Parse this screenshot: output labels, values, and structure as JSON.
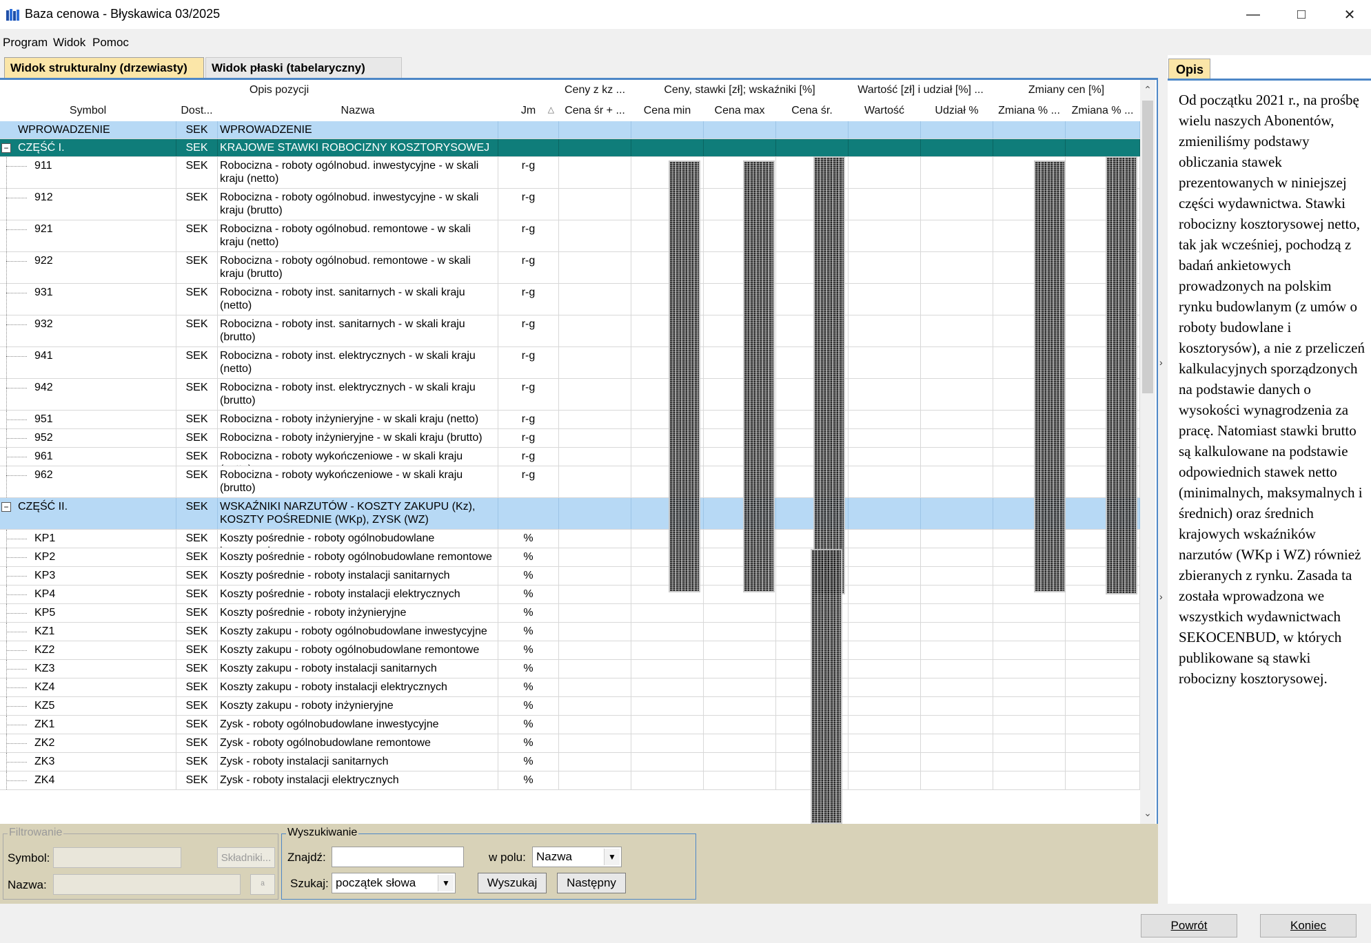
{
  "window": {
    "title": "Baza cenowa - Błyskawica 03/2025",
    "icon": "books-icon"
  },
  "menu": [
    "Program",
    "Widok",
    "Pomoc"
  ],
  "tabs": {
    "structural": "Widok strukturalny (drzewiasty)",
    "flat": "Widok płaski (tabelaryczny)"
  },
  "grid": {
    "group_headers": [
      "Opis pozycji",
      "Ceny z kz ...",
      "Ceny, stawki [zł]; wskaźniki [%]",
      "Wartość [zł] i udział [%] ...",
      "Zmiany cen [%]"
    ],
    "columns": [
      "Symbol",
      "Dost...",
      "Nazwa",
      "Jm",
      "Cena śr + ...",
      "Cena min",
      "Cena max",
      "Cena śr.",
      "Wartość",
      "Udział %",
      "Zmiana % ...",
      "Zmiana % ..."
    ],
    "rows": [
      {
        "symbol": "WPROWADZENIE",
        "dost": "SEK",
        "name": "WPROWADZENIE",
        "jm": "",
        "type": "section-blue"
      },
      {
        "symbol": "CZĘŚĆ I.",
        "dost": "SEK",
        "name": "KRAJOWE STAWKI ROBOCIZNY KOSZTORYSOWEJ",
        "jm": "",
        "type": "section-teal"
      },
      {
        "symbol": "911",
        "dost": "SEK",
        "name": "Robocizna - roboty ogólnobud. inwestycyjne - w skali kraju (netto)",
        "jm": "r-g"
      },
      {
        "symbol": "912",
        "dost": "SEK",
        "name": "Robocizna - roboty ogólnobud. inwestycyjne - w skali kraju (brutto)",
        "jm": "r-g"
      },
      {
        "symbol": "921",
        "dost": "SEK",
        "name": "Robocizna - roboty ogólnobud. remontowe - w skali kraju (netto)",
        "jm": "r-g"
      },
      {
        "symbol": "922",
        "dost": "SEK",
        "name": "Robocizna - roboty ogólnobud. remontowe - w skali kraju (brutto)",
        "jm": "r-g"
      },
      {
        "symbol": "931",
        "dost": "SEK",
        "name": "Robocizna - roboty inst. sanitarnych - w skali kraju (netto)",
        "jm": "r-g"
      },
      {
        "symbol": "932",
        "dost": "SEK",
        "name": "Robocizna - roboty inst. sanitarnych - w skali kraju (brutto)",
        "jm": "r-g"
      },
      {
        "symbol": "941",
        "dost": "SEK",
        "name": "Robocizna - roboty inst. elektrycznych - w skali kraju (netto)",
        "jm": "r-g"
      },
      {
        "symbol": "942",
        "dost": "SEK",
        "name": "Robocizna - roboty inst. elektrycznych - w skali kraju (brutto)",
        "jm": "r-g"
      },
      {
        "symbol": "951",
        "dost": "SEK",
        "name": "Robocizna - roboty inżynieryjne - w skali kraju (netto)",
        "jm": "r-g"
      },
      {
        "symbol": "952",
        "dost": "SEK",
        "name": "Robocizna - roboty inżynieryjne - w skali kraju (brutto)",
        "jm": "r-g"
      },
      {
        "symbol": "961",
        "dost": "SEK",
        "name": "Robocizna - roboty wykończeniowe - w skali kraju (netto)",
        "jm": "r-g"
      },
      {
        "symbol": "962",
        "dost": "SEK",
        "name": "Robocizna - roboty wykończeniowe - w skali kraju (brutto)",
        "jm": "r-g"
      },
      {
        "symbol": "CZĘŚĆ II.",
        "dost": "SEK",
        "name": "WSKAŹNIKI NARZUTÓW - KOSZTY ZAKUPU (Kz), KOSZTY POŚREDNIE (WKp), ZYSK (WZ)",
        "jm": "",
        "type": "section-blue"
      },
      {
        "symbol": "KP1",
        "dost": "SEK",
        "name": "Koszty pośrednie - roboty ogólnobudowlane inwestycyjne",
        "jm": "%"
      },
      {
        "symbol": "KP2",
        "dost": "SEK",
        "name": "Koszty pośrednie - roboty ogólnobudowlane remontowe",
        "jm": "%"
      },
      {
        "symbol": "KP3",
        "dost": "SEK",
        "name": "Koszty pośrednie - roboty instalacji sanitarnych",
        "jm": "%"
      },
      {
        "symbol": "KP4",
        "dost": "SEK",
        "name": "Koszty pośrednie - roboty instalacji elektrycznych",
        "jm": "%"
      },
      {
        "symbol": "KP5",
        "dost": "SEK",
        "name": "Koszty pośrednie - roboty inżynieryjne",
        "jm": "%"
      },
      {
        "symbol": "KZ1",
        "dost": "SEK",
        "name": "Koszty zakupu - roboty ogólnobudowlane inwestycyjne",
        "jm": "%"
      },
      {
        "symbol": "KZ2",
        "dost": "SEK",
        "name": "Koszty zakupu - roboty ogólnobudowlane remontowe",
        "jm": "%"
      },
      {
        "symbol": "KZ3",
        "dost": "SEK",
        "name": "Koszty zakupu - roboty instalacji sanitarnych",
        "jm": "%"
      },
      {
        "symbol": "KZ4",
        "dost": "SEK",
        "name": "Koszty zakupu - roboty instalacji elektrycznych",
        "jm": "%"
      },
      {
        "symbol": "KZ5",
        "dost": "SEK",
        "name": "Koszty zakupu - roboty inżynieryjne",
        "jm": "%"
      },
      {
        "symbol": "ZK1",
        "dost": "SEK",
        "name": "Zysk - roboty ogólnobudowlane inwestycyjne",
        "jm": "%"
      },
      {
        "symbol": "ZK2",
        "dost": "SEK",
        "name": "Zysk - roboty ogólnobudowlane remontowe",
        "jm": "%"
      },
      {
        "symbol": "ZK3",
        "dost": "SEK",
        "name": "Zysk - roboty instalacji sanitarnych",
        "jm": "%"
      },
      {
        "symbol": "ZK4",
        "dost": "SEK",
        "name": "Zysk - roboty instalacji elektrycznych",
        "jm": "%"
      }
    ]
  },
  "filter": {
    "legend": "Filtrowanie",
    "symbol_label": "Symbol:",
    "name_label": "Nazwa:",
    "components_button": "Składniki...",
    "symbol_value": "",
    "name_value": ""
  },
  "search": {
    "legend": "Wyszukiwanie",
    "find_label": "Znajdź:",
    "find_value": "",
    "field_label": "w polu:",
    "field_value": "Nazwa",
    "mode_label": "Szukaj:",
    "mode_value": "początek słowa",
    "search_button": "Wyszukaj",
    "next_button": "Następny"
  },
  "description": {
    "tab": "Opis",
    "text": "Od początku 2021 r., na prośbę wielu naszych Abonentów, zmieniliśmy podstawy obliczania stawek prezentowanych w niniejszej części wydawnictwa. Stawki robocizny kosztorysowej netto, tak jak wcześniej, pochodzą z badań ankietowych prowadzonych na polskim rynku budowlanym (z umów o roboty budowlane i kosztorysów), a nie z przeliczeń kalkulacyjnych sporządzonych na podstawie danych o wysokości wynagrodzenia za pracę. Natomiast stawki brutto są kalkulowane na podstawie odpowiednich stawek netto (minimalnych, maksymalnych i średnich) oraz średnich krajowych wskaźników narzutów (WKp i WZ) również zbieranych z rynku. Zasada ta została wprowadzona we wszystkich wydawnictwach SEKOCENBUD, w których publikowane są stawki robocizny kosztorysowej."
  },
  "footer": {
    "back_button": "Powrót",
    "end_button": "Koniec"
  },
  "colors": {
    "accent": "#4d87c7",
    "header": "#b7d5f4",
    "section_teal": "#0f7d7a",
    "tab_active": "#fbe6a8"
  }
}
